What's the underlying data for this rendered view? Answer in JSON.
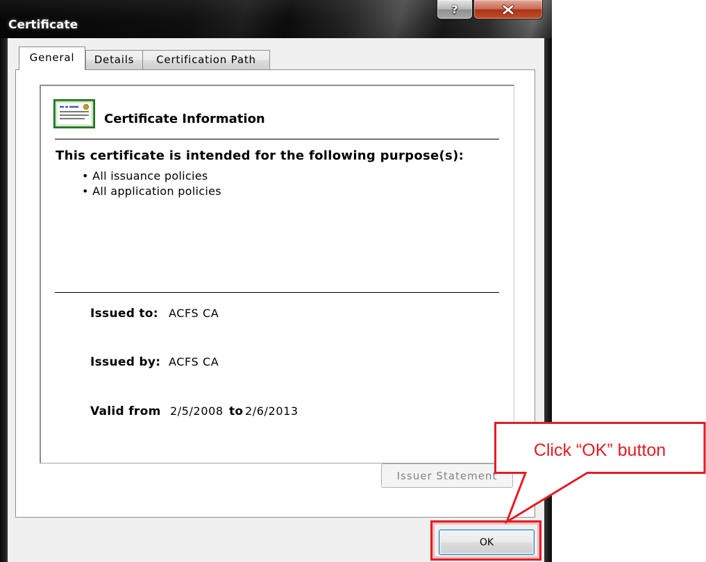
{
  "window": {
    "title": "Certificate",
    "help_icon": "help-icon",
    "close_icon": "close-icon"
  },
  "tabs": [
    {
      "label": "General",
      "selected": true
    },
    {
      "label": "Details",
      "selected": false
    },
    {
      "label": "Certification Path",
      "selected": false
    }
  ],
  "general": {
    "icon": "certificate-icon",
    "heading": "Certificate Information",
    "purpose_heading": "This certificate is intended for the following purpose(s):",
    "purposes": [
      "All issuance policies",
      "All application policies"
    ],
    "issued_to": {
      "label": "Issued to:",
      "value": "ACFS CA"
    },
    "issued_by": {
      "label": "Issued by:",
      "value": "ACFS CA"
    },
    "valid_from": {
      "label": "Valid from",
      "value": "2/5/2008"
    },
    "valid_to": {
      "label": "to",
      "value": "2/6/2013"
    },
    "issuer_statement": {
      "label": "Issuer Statement",
      "enabled": false
    }
  },
  "footer": {
    "ok_label": "OK"
  },
  "annotation": {
    "callout_text": "Click “OK” button",
    "color": "#e31b23"
  }
}
